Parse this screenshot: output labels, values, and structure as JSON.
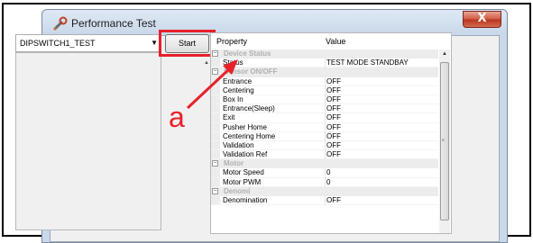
{
  "window": {
    "title": "Performance Test",
    "close_glyph": "X"
  },
  "combo": {
    "value": "DIPSWITCH1_TEST",
    "arrow": "▼"
  },
  "start_label": "Start",
  "annotation_label": "a",
  "grid": {
    "header_property": "Property",
    "header_value": "Value",
    "rows": [
      {
        "type": "cat",
        "label": "Device Status"
      },
      {
        "type": "prop",
        "name": "Status",
        "value": "TEST MODE STANDBAY"
      },
      {
        "type": "cat",
        "label": "Sensor ON/OFF"
      },
      {
        "type": "prop",
        "name": "Entrance",
        "value": "OFF"
      },
      {
        "type": "prop",
        "name": "Centering",
        "value": "OFF"
      },
      {
        "type": "prop",
        "name": "Box In",
        "value": "OFF"
      },
      {
        "type": "prop",
        "name": "Entrance(Sleep)",
        "value": "OFF"
      },
      {
        "type": "prop",
        "name": "Exit",
        "value": "OFF"
      },
      {
        "type": "prop",
        "name": "Pusher Home",
        "value": "OFF"
      },
      {
        "type": "prop",
        "name": "Centering Home",
        "value": "OFF"
      },
      {
        "type": "prop",
        "name": "Validation",
        "value": "OFF"
      },
      {
        "type": "prop",
        "name": "Validation Ref",
        "value": "OFF"
      },
      {
        "type": "cat",
        "label": "Motor"
      },
      {
        "type": "prop",
        "name": "Motor Speed",
        "value": "0"
      },
      {
        "type": "prop",
        "name": "Motor PWM",
        "value": "0"
      },
      {
        "type": "cat",
        "label": "Denomi"
      },
      {
        "type": "prop",
        "name": "Denomination",
        "value": "OFF"
      }
    ]
  },
  "colors": {
    "highlight": "#e8202a"
  },
  "icons": {
    "app": "wrench-icon",
    "collapse": "collapse-icon",
    "dropdown": "chevron-down-icon"
  }
}
